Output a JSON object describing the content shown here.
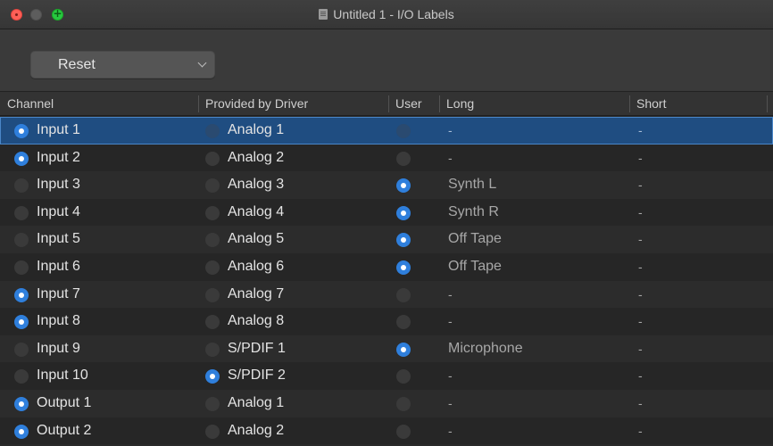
{
  "window": {
    "title": "Untitled 1 - I/O Labels"
  },
  "toolbar": {
    "reset_label": "Reset"
  },
  "columns": {
    "channel": "Channel",
    "driver": "Provided by Driver",
    "user": "User",
    "long": "Long",
    "short": "Short"
  },
  "colors": {
    "accent": "#2f7fdc",
    "selection": "#1f4d81"
  },
  "rows": [
    {
      "channel": "Input 1",
      "channel_on": true,
      "driver": "Analog 1",
      "driver_on": false,
      "user_on": false,
      "long": "-",
      "short": "-",
      "selected": true
    },
    {
      "channel": "Input 2",
      "channel_on": true,
      "driver": "Analog 2",
      "driver_on": false,
      "user_on": false,
      "long": "-",
      "short": "-"
    },
    {
      "channel": "Input 3",
      "channel_on": false,
      "driver": "Analog 3",
      "driver_on": false,
      "user_on": true,
      "long": "Synth L",
      "short": "-"
    },
    {
      "channel": "Input 4",
      "channel_on": false,
      "driver": "Analog 4",
      "driver_on": false,
      "user_on": true,
      "long": "Synth R",
      "short": "-"
    },
    {
      "channel": "Input 5",
      "channel_on": false,
      "driver": "Analog 5",
      "driver_on": false,
      "user_on": true,
      "long": "Off Tape",
      "short": "-"
    },
    {
      "channel": "Input 6",
      "channel_on": false,
      "driver": "Analog 6",
      "driver_on": false,
      "user_on": true,
      "long": "Off Tape",
      "short": "-"
    },
    {
      "channel": "Input 7",
      "channel_on": true,
      "driver": "Analog 7",
      "driver_on": false,
      "user_on": false,
      "long": "-",
      "short": "-"
    },
    {
      "channel": "Input 8",
      "channel_on": true,
      "driver": "Analog 8",
      "driver_on": false,
      "user_on": false,
      "long": "-",
      "short": "-"
    },
    {
      "channel": "Input 9",
      "channel_on": false,
      "driver": "S/PDIF 1",
      "driver_on": false,
      "user_on": true,
      "long": "Microphone",
      "short": "-"
    },
    {
      "channel": "Input 10",
      "channel_on": false,
      "driver": "S/PDIF 2",
      "driver_on": true,
      "user_on": false,
      "long": "-",
      "short": "-"
    },
    {
      "channel": "Output 1",
      "channel_on": true,
      "driver": "Analog 1",
      "driver_on": false,
      "user_on": false,
      "long": "-",
      "short": "-"
    },
    {
      "channel": "Output 2",
      "channel_on": true,
      "driver": "Analog 2",
      "driver_on": false,
      "user_on": false,
      "long": "-",
      "short": "-"
    }
  ]
}
